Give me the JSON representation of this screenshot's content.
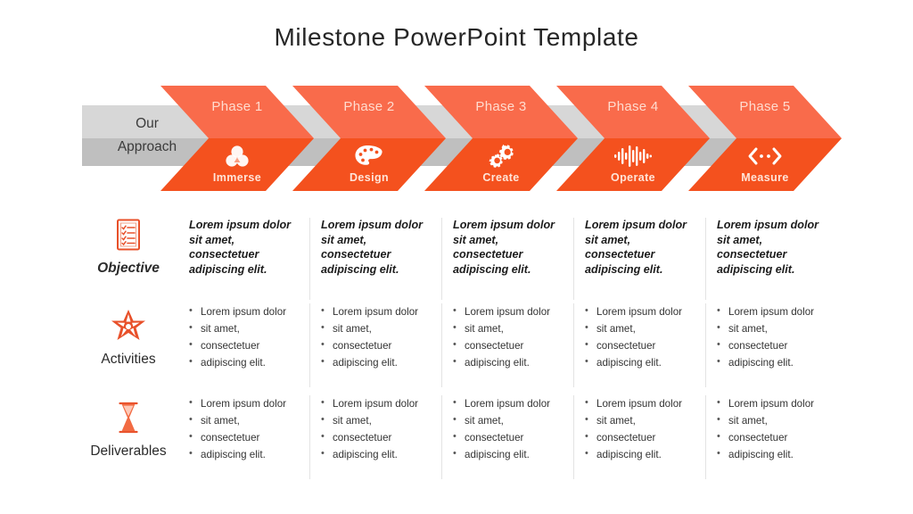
{
  "slide": {
    "title": "Milestone PowerPoint Template",
    "approach_line1": "Our",
    "approach_line2": "Approach"
  },
  "colors": {
    "chevron_light": "#f96b4b",
    "chevron_dark": "#f4511e",
    "gray_light": "#d7d7d7",
    "gray_dark": "#bfbfbf",
    "phase_text": "#ffdccf",
    "icon_accent": "#e8502a",
    "title_text": "#262626"
  },
  "phases": [
    {
      "phase_label": "Phase 1",
      "stage_label": "Immerse",
      "icon": "venn-circles-icon"
    },
    {
      "phase_label": "Phase 2",
      "stage_label": "Design",
      "icon": "paint-palette-icon"
    },
    {
      "phase_label": "Phase 3",
      "stage_label": "Create",
      "icon": "gears-icon"
    },
    {
      "phase_label": "Phase 4",
      "stage_label": "Operate",
      "icon": "audio-waveform-icon"
    },
    {
      "phase_label": "Phase 5",
      "stage_label": "Measure",
      "icon": "expand-arrows-icon"
    }
  ],
  "rows": [
    {
      "label": "Objective",
      "icon": "checklist-clipboard-icon",
      "type": "paragraph",
      "cells": [
        "Lorem ipsum dolor sit amet, consectetuer adipiscing elit.",
        "Lorem ipsum dolor sit amet, consectetuer adipiscing elit.",
        "Lorem ipsum dolor sit amet, consectetuer adipiscing elit.",
        "Lorem ipsum dolor sit amet, consectetuer adipiscing elit.",
        "Lorem ipsum dolor sit amet, consectetuer adipiscing elit."
      ]
    },
    {
      "label": "Activities",
      "icon": "star-burst-icon",
      "type": "bullets",
      "cells": [
        [
          "Lorem ipsum dolor",
          "sit amet,",
          "consectetuer",
          "adipiscing elit."
        ],
        [
          "Lorem ipsum dolor",
          "sit amet,",
          "consectetuer",
          "adipiscing elit."
        ],
        [
          "Lorem ipsum dolor",
          "sit amet,",
          "consectetuer",
          "adipiscing elit."
        ],
        [
          "Lorem ipsum dolor",
          "sit amet,",
          "consectetuer",
          "adipiscing elit."
        ],
        [
          "Lorem ipsum dolor",
          "sit amet,",
          "consectetuer",
          "adipiscing elit."
        ]
      ]
    },
    {
      "label": "Deliverables",
      "icon": "hourglass-icon",
      "type": "bullets",
      "cells": [
        [
          "Lorem ipsum dolor",
          "sit amet,",
          "consectetuer",
          "adipiscing elit."
        ],
        [
          "Lorem ipsum dolor",
          "sit amet,",
          "consectetuer",
          "adipiscing elit."
        ],
        [
          "Lorem ipsum dolor",
          "sit amet,",
          "consectetuer",
          "adipiscing elit."
        ],
        [
          "Lorem ipsum dolor",
          "sit amet,",
          "consectetuer",
          "adipiscing elit."
        ],
        [
          "Lorem ipsum dolor",
          "sit amet,",
          "consectetuer",
          "adipiscing elit."
        ]
      ]
    }
  ]
}
